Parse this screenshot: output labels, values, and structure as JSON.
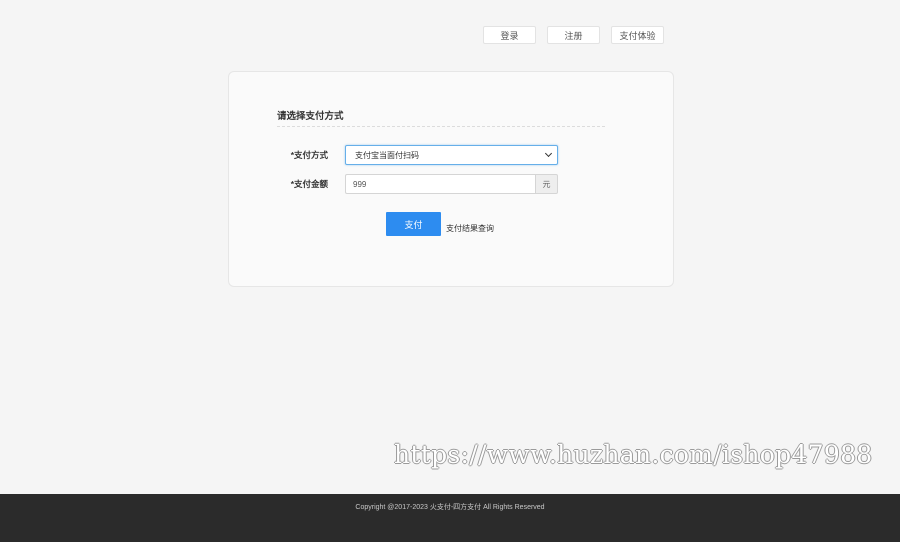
{
  "nav": {
    "login": "登录",
    "register": "注册",
    "pay_demo": "支付体验"
  },
  "form": {
    "section_title": "请选择支付方式",
    "method_label": "*支付方式",
    "method_value": "支付宝当面付扫码",
    "amount_label": "*支付金额",
    "amount_value": "999",
    "amount_unit": "元",
    "pay_button": "支付",
    "query_link": "支付结果查询"
  },
  "watermark": "https://www.huzhan.com/ishop47988",
  "footer": {
    "copyright": "Copyright @2017-2023 火支付-四方支付 All Rights Reserved"
  },
  "colors": {
    "primary": "#2d8cf0",
    "footer_bg": "#2b2b2b",
    "page_bg": "#f5f5f5"
  }
}
